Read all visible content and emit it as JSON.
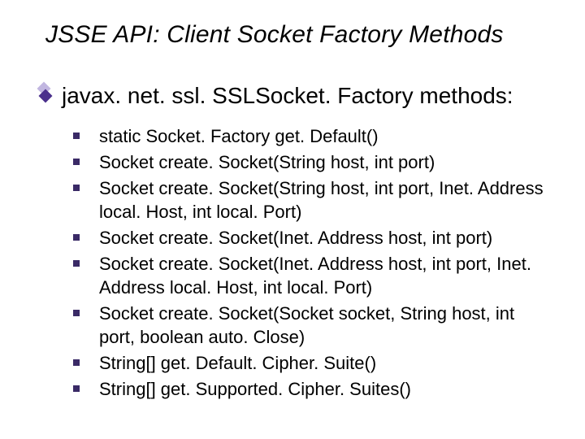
{
  "title": "JSSE API: Client Socket Factory Methods",
  "lead": "javax. net. ssl. SSLSocket. Factory methods:",
  "methods": [
    "static Socket. Factory get. Default()",
    "Socket create. Socket(String host, int port)",
    "Socket create. Socket(String host, int port, Inet. Address local. Host, int local. Port)",
    "Socket create. Socket(Inet. Address host, int port)",
    "Socket create. Socket(Inet. Address host, int port, Inet. Address local. Host, int local. Port)",
    "Socket create. Socket(Socket socket, String host, int port, boolean auto. Close)",
    "String[] get. Default. Cipher. Suite()",
    "String[] get. Supported. Cipher. Suites()"
  ]
}
